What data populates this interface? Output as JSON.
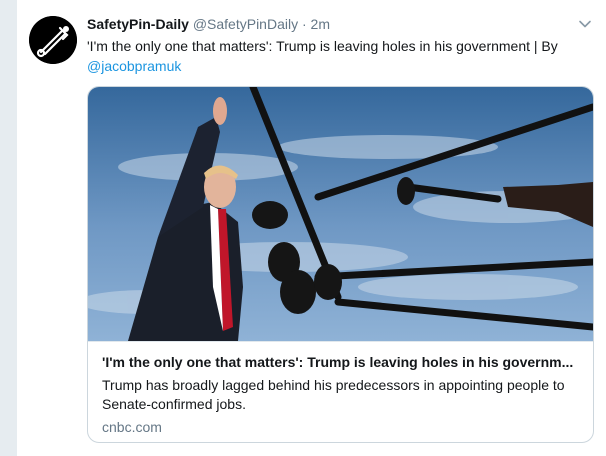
{
  "tweet": {
    "display_name": "SafetyPin-Daily",
    "handle": "@SafetyPinDaily",
    "separator": "·",
    "time": "2m",
    "text": "'I'm the only one that matters': Trump is leaving holes in his government  | By",
    "mention": "@jacobpramuk",
    "avatar_icon": "safety-pin-icon",
    "menu_icon": "chevron-down-icon"
  },
  "card": {
    "image_icon": "news-photo",
    "title": "'I'm the only one that matters': Trump is leaving holes in his governm...",
    "description": "Trump has broadly lagged behind his predecessors in appointing people to Senate-confirmed jobs.",
    "domain": "cnbc.com"
  },
  "colors": {
    "background": "#e6ecf0",
    "link": "#1b95e0",
    "secondary_text": "#657786",
    "border": "#ccd6dd"
  }
}
